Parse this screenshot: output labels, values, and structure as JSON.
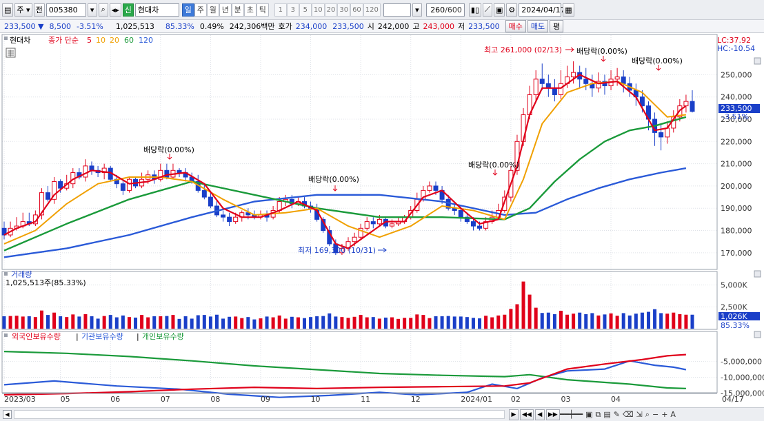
{
  "toolbar": {
    "type_label": "주",
    "prev_label": "전",
    "code": "005380",
    "badge": "신",
    "name": "현대차",
    "periods": [
      "일",
      "주",
      "월",
      "년",
      "분",
      "초",
      "틱"
    ],
    "active_period": "일",
    "intervals": [
      "1",
      "3",
      "5",
      "10",
      "20",
      "30",
      "60",
      "120"
    ],
    "count": "260",
    "count_max": "/600",
    "date": "2024/04/17"
  },
  "quote": {
    "price": "233,500",
    "change": "8,500",
    "change_pct": "-3.51%",
    "volume": "1,025,513",
    "vol_ratio": "85.33%",
    "turnover_pct": "0.49%",
    "amount": "242,306백만",
    "ask_label": "호가",
    "ask1": "234,000",
    "ask2": "233,500",
    "open_label": "시",
    "open": "242,000",
    "high_label": "고",
    "high": "243,000",
    "low_label": "저",
    "low": "233,500",
    "buy": "매수",
    "sell": "매도",
    "eval": "평"
  },
  "legend": {
    "stock": "현대차",
    "ma_prefix": "종가 단순",
    "ma": [
      {
        "p": "5",
        "c": "#e0001a"
      },
      {
        "p": "10",
        "c": "#f0a000"
      },
      {
        "p": "20",
        "c": "#f0a000"
      },
      {
        "p": "60",
        "c": "#1a9a3a"
      },
      {
        "p": "120",
        "c": "#2a5ad8"
      }
    ],
    "lc": "LC:37.92",
    "hc": "HC:-10.54"
  },
  "chart_data": {
    "type": "line",
    "x_ticks": [
      "2023/03",
      "05",
      "06",
      "07",
      "08",
      "09",
      "10",
      "11",
      "12",
      "2024/01",
      "02",
      "03",
      "04",
      "04/17"
    ],
    "price_axis": [
      "250,000",
      "240,000",
      "230,000",
      "220,000",
      "210,000",
      "200,000",
      "190,000",
      "180,000",
      "170,000"
    ],
    "price_ylim": [
      165000,
      256000
    ],
    "last_price": "233,500",
    "last_pct": "-3.51%",
    "annotations": {
      "high": "최고 261,000 (02/13)",
      "low": "최저 169,300 (10/31)",
      "dividend": [
        "배당락(0.00%)",
        "배당락(0.00%)",
        "배당락(0.00%)",
        "배당락(0.00%)",
        "배당락(0.00%)"
      ]
    },
    "volume": {
      "title": "거래량",
      "value": "1,025,513주(85.33%)",
      "axis": [
        "5,000K",
        "2,500K"
      ],
      "last": "1,026K",
      "last_pct": "85.33%"
    },
    "holdings": {
      "series": [
        "외국인보유수량",
        "기관보유수량",
        "개인보유수량"
      ],
      "axis": [
        "-5,000,000",
        "-10,000,000",
        "-15,000,000"
      ]
    },
    "candles": [
      [
        181,
        178,
        184,
        176
      ],
      [
        178,
        181,
        184,
        177
      ],
      [
        181,
        182,
        186,
        180
      ],
      [
        182,
        184,
        188,
        181
      ],
      [
        184,
        183,
        188,
        182
      ],
      [
        183,
        187,
        189,
        182
      ],
      [
        187,
        197,
        199,
        185
      ],
      [
        197,
        194,
        200,
        193
      ],
      [
        194,
        202,
        204,
        192
      ],
      [
        202,
        199,
        203,
        197
      ],
      [
        199,
        201,
        205,
        198
      ],
      [
        201,
        206,
        208,
        199
      ],
      [
        206,
        204,
        208,
        203
      ],
      [
        204,
        209,
        212,
        202
      ],
      [
        209,
        207,
        211,
        205
      ],
      [
        207,
        206,
        209,
        204
      ],
      [
        206,
        208,
        210,
        203
      ],
      [
        208,
        203,
        209,
        202
      ],
      [
        203,
        201,
        205,
        199
      ],
      [
        201,
        198,
        203,
        196
      ],
      [
        198,
        203,
        204,
        197
      ],
      [
        203,
        200,
        204,
        199
      ],
      [
        200,
        203,
        206,
        199
      ],
      [
        203,
        205,
        207,
        201
      ],
      [
        205,
        203,
        207,
        201
      ],
      [
        203,
        207,
        210,
        202
      ],
      [
        207,
        204,
        210,
        203
      ],
      [
        204,
        207,
        210,
        203
      ],
      [
        207,
        206,
        208,
        204
      ],
      [
        206,
        204,
        208,
        202
      ],
      [
        204,
        202,
        206,
        201
      ],
      [
        202,
        198,
        205,
        197
      ],
      [
        198,
        195,
        201,
        194
      ],
      [
        195,
        191,
        197,
        190
      ],
      [
        191,
        187,
        194,
        186
      ],
      [
        187,
        186,
        189,
        184
      ],
      [
        186,
        184,
        188,
        182
      ],
      [
        184,
        186,
        188,
        183
      ],
      [
        186,
        188,
        189,
        184
      ],
      [
        188,
        187,
        190,
        185
      ],
      [
        187,
        186,
        189,
        185
      ],
      [
        186,
        187,
        189,
        185
      ],
      [
        187,
        186,
        189,
        184
      ],
      [
        186,
        189,
        191,
        185
      ],
      [
        189,
        193,
        195,
        188
      ],
      [
        193,
        194,
        196,
        191
      ],
      [
        194,
        192,
        196,
        190
      ],
      [
        192,
        193,
        195,
        191
      ],
      [
        193,
        191,
        195,
        190
      ],
      [
        191,
        190,
        193,
        188
      ],
      [
        190,
        185,
        192,
        184
      ],
      [
        185,
        180,
        186,
        179
      ],
      [
        180,
        174,
        182,
        173
      ],
      [
        174,
        170,
        176,
        169
      ],
      [
        170,
        172,
        174,
        169
      ],
      [
        172,
        175,
        177,
        171
      ],
      [
        175,
        177,
        179,
        173
      ],
      [
        177,
        181,
        183,
        176
      ],
      [
        181,
        184,
        186,
        180
      ],
      [
        184,
        183,
        186,
        181
      ],
      [
        183,
        185,
        187,
        182
      ],
      [
        185,
        182,
        186,
        181
      ],
      [
        182,
        183,
        185,
        181
      ],
      [
        183,
        184,
        186,
        182
      ],
      [
        184,
        186,
        187,
        183
      ],
      [
        186,
        189,
        191,
        185
      ],
      [
        189,
        194,
        197,
        188
      ],
      [
        194,
        198,
        200,
        193
      ],
      [
        198,
        200,
        202,
        197
      ],
      [
        200,
        198,
        202,
        196
      ],
      [
        198,
        194,
        200,
        192
      ],
      [
        194,
        190,
        196,
        189
      ],
      [
        190,
        189,
        192,
        187
      ],
      [
        189,
        186,
        191,
        184
      ],
      [
        186,
        184,
        188,
        183
      ],
      [
        184,
        182,
        186,
        180
      ],
      [
        182,
        181,
        184,
        180
      ],
      [
        181,
        184,
        186,
        180
      ],
      [
        184,
        186,
        189,
        183
      ],
      [
        186,
        189,
        192,
        185
      ],
      [
        189,
        195,
        198,
        188
      ],
      [
        195,
        207,
        209,
        193
      ],
      [
        207,
        220,
        223,
        205
      ],
      [
        220,
        232,
        235,
        218
      ],
      [
        232,
        241,
        245,
        230
      ],
      [
        241,
        248,
        252,
        238
      ],
      [
        248,
        246,
        255,
        243
      ],
      [
        246,
        244,
        250,
        240
      ],
      [
        244,
        241,
        248,
        238
      ],
      [
        241,
        246,
        252,
        239
      ],
      [
        246,
        249,
        254,
        244
      ],
      [
        249,
        251,
        256,
        246
      ],
      [
        251,
        248,
        254,
        244
      ],
      [
        248,
        246,
        253,
        243
      ],
      [
        246,
        244,
        250,
        240
      ],
      [
        244,
        247,
        251,
        242
      ],
      [
        247,
        245,
        250,
        241
      ],
      [
        245,
        248,
        252,
        243
      ],
      [
        248,
        249,
        253,
        245
      ],
      [
        249,
        246,
        252,
        242
      ],
      [
        246,
        243,
        249,
        240
      ],
      [
        243,
        240,
        246,
        236
      ],
      [
        240,
        236,
        243,
        233
      ],
      [
        236,
        230,
        238,
        225
      ],
      [
        230,
        224,
        233,
        218
      ],
      [
        224,
        222,
        228,
        216
      ],
      [
        222,
        226,
        229,
        219
      ],
      [
        226,
        231,
        234,
        224
      ],
      [
        231,
        236,
        239,
        229
      ],
      [
        236,
        238,
        241,
        233
      ],
      [
        238,
        233.5,
        243,
        233
      ]
    ],
    "ma5": [
      [
        0,
        178
      ],
      [
        2,
        181
      ],
      [
        5,
        184
      ],
      [
        8,
        196
      ],
      [
        11,
        203
      ],
      [
        14,
        207
      ],
      [
        17,
        206
      ],
      [
        20,
        201
      ],
      [
        23,
        202
      ],
      [
        26,
        205
      ],
      [
        29,
        206
      ],
      [
        32,
        201
      ],
      [
        35,
        190
      ],
      [
        38,
        186
      ],
      [
        41,
        186
      ],
      [
        44,
        189
      ],
      [
        47,
        193
      ],
      [
        50,
        189
      ],
      [
        53,
        174
      ],
      [
        55,
        172
      ],
      [
        58,
        178
      ],
      [
        61,
        184
      ],
      [
        64,
        184
      ],
      [
        67,
        195
      ],
      [
        70,
        198
      ],
      [
        73,
        190
      ],
      [
        76,
        183
      ],
      [
        79,
        185
      ],
      [
        82,
        209
      ],
      [
        84,
        232
      ],
      [
        86,
        244
      ],
      [
        89,
        244
      ],
      [
        92,
        250
      ],
      [
        95,
        246
      ],
      [
        98,
        247
      ],
      [
        101,
        240
      ],
      [
        104,
        225
      ],
      [
        106,
        226
      ],
      [
        108,
        234
      ],
      [
        109,
        236
      ]
    ],
    "ma20": [
      [
        0,
        174
      ],
      [
        5,
        180
      ],
      [
        10,
        192
      ],
      [
        15,
        201
      ],
      [
        20,
        204
      ],
      [
        25,
        204
      ],
      [
        30,
        202
      ],
      [
        35,
        194
      ],
      [
        40,
        187
      ],
      [
        45,
        188
      ],
      [
        50,
        190
      ],
      [
        55,
        182
      ],
      [
        60,
        177
      ],
      [
        65,
        182
      ],
      [
        70,
        191
      ],
      [
        75,
        189
      ],
      [
        80,
        185
      ],
      [
        83,
        203
      ],
      [
        86,
        228
      ],
      [
        90,
        242
      ],
      [
        94,
        246
      ],
      [
        98,
        247
      ],
      [
        102,
        242
      ],
      [
        106,
        231
      ],
      [
        109,
        232
      ]
    ],
    "ma60": [
      [
        0,
        171
      ],
      [
        10,
        183
      ],
      [
        20,
        194
      ],
      [
        30,
        202
      ],
      [
        40,
        196
      ],
      [
        50,
        190
      ],
      [
        60,
        186
      ],
      [
        70,
        186
      ],
      [
        80,
        185
      ],
      [
        84,
        190
      ],
      [
        88,
        202
      ],
      [
        92,
        212
      ],
      [
        96,
        220
      ],
      [
        100,
        225
      ],
      [
        104,
        227
      ],
      [
        109,
        231
      ]
    ],
    "ma120": [
      [
        0,
        168
      ],
      [
        10,
        172
      ],
      [
        20,
        178
      ],
      [
        30,
        186
      ],
      [
        40,
        193
      ],
      [
        50,
        196
      ],
      [
        60,
        196
      ],
      [
        70,
        193
      ],
      [
        80,
        187
      ],
      [
        85,
        188
      ],
      [
        90,
        194
      ],
      [
        95,
        199
      ],
      [
        100,
        203
      ],
      [
        105,
        206
      ],
      [
        109,
        208
      ]
    ]
  },
  "status": {
    "page_btns": [
      "▶",
      "◀◀",
      "◀",
      "▶▶"
    ]
  }
}
